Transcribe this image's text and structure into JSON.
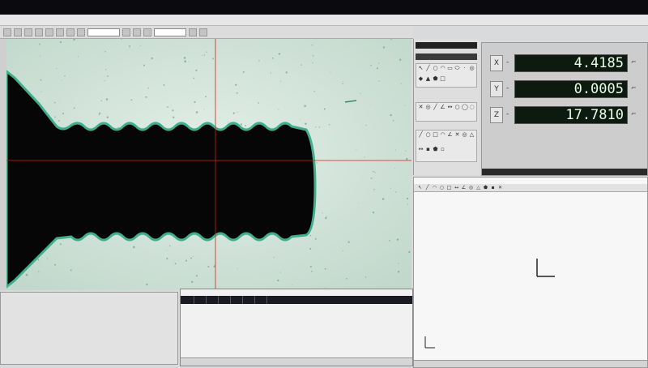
{
  "app": {
    "title": ""
  },
  "menu": {
    "items": [
      "",
      "",
      "",
      "",
      "",
      "",
      "",
      "",
      "",
      "",
      "",
      ""
    ]
  },
  "toolbar": {
    "zoom_field": "",
    "field2": ""
  },
  "dro": {
    "rows": [
      {
        "axis": "X",
        "sign": "-",
        "value": "4.4185"
      },
      {
        "axis": "Y",
        "sign": "-",
        "value": "0.0005"
      },
      {
        "axis": "Z",
        "sign": "-",
        "value": "17.7810"
      }
    ],
    "status": [
      "",
      "",
      ""
    ]
  },
  "bottom_panel": {
    "tabs": [
      "",
      "",
      "",
      "",
      "",
      "",
      ""
    ],
    "footer": [
      "",
      "",
      "",
      "",
      ""
    ]
  },
  "graphics": {
    "status": [
      "",
      ""
    ]
  },
  "colors": {
    "dro_bg": "#0d1a10",
    "dro_text": "#e8ffe8",
    "crosshair": "#cc2222",
    "part_shadow": "#060606",
    "edge_glow": "#3fae8c"
  },
  "icons": [
    "pointer-icon",
    "line-tool-icon",
    "circle-tool-icon",
    "arc-tool-icon",
    "rectangle-tool-icon",
    "point-tool-icon",
    "distance-tool-icon",
    "angle-tool-icon",
    "axis-origin-icon"
  ]
}
